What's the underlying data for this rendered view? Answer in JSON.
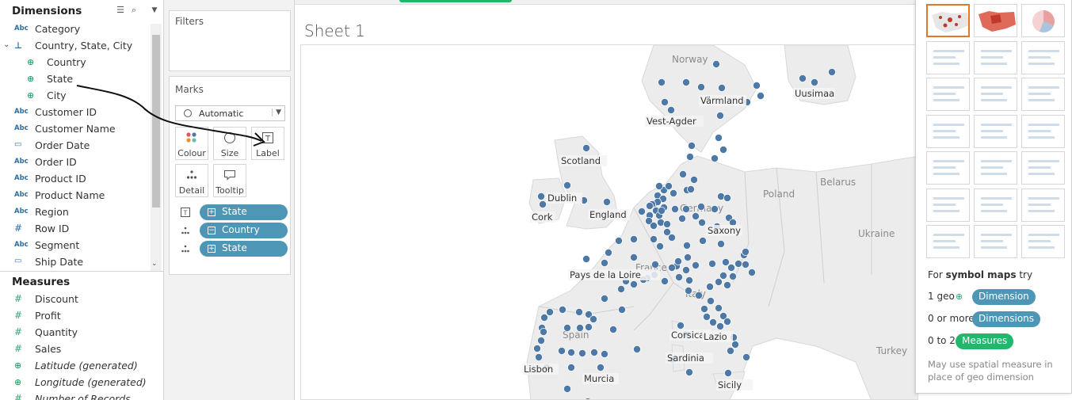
{
  "data_pane": {
    "dimensions_title": "Dimensions",
    "dimensions": [
      {
        "type": "Abc",
        "label": "Category"
      },
      {
        "type": "hier",
        "label": "Country, State, City",
        "expanded": true
      },
      {
        "type": "globe",
        "label": "Country",
        "child": true
      },
      {
        "type": "globe",
        "label": "State",
        "child": true
      },
      {
        "type": "globe",
        "label": "City",
        "child": true
      },
      {
        "type": "Abc",
        "label": "Customer ID"
      },
      {
        "type": "Abc",
        "label": "Customer Name"
      },
      {
        "type": "date",
        "label": "Order Date"
      },
      {
        "type": "Abc",
        "label": "Order ID"
      },
      {
        "type": "Abc",
        "label": "Product ID"
      },
      {
        "type": "Abc",
        "label": "Product Name"
      },
      {
        "type": "Abc",
        "label": "Region"
      },
      {
        "type": "#",
        "label": "Row ID"
      },
      {
        "type": "Abc",
        "label": "Segment"
      },
      {
        "type": "date",
        "label": "Ship Date"
      }
    ],
    "measures_title": "Measures",
    "measures": [
      {
        "type": "#",
        "label": "Discount"
      },
      {
        "type": "#",
        "label": "Profit"
      },
      {
        "type": "#",
        "label": "Quantity"
      },
      {
        "type": "#",
        "label": "Sales"
      },
      {
        "type": "globe",
        "label": "Latitude (generated)",
        "italic": true
      },
      {
        "type": "globe",
        "label": "Longitude (generated)",
        "italic": true
      },
      {
        "type": "#",
        "label": "Number of Records",
        "italic": true
      }
    ]
  },
  "shelves": {
    "filters_title": "Filters",
    "marks_title": "Marks",
    "mark_type": "Automatic",
    "mark_buttons": [
      "Colour",
      "Size",
      "Label",
      "Detail",
      "Tooltip"
    ],
    "mark_pills": [
      {
        "role": "label",
        "name": "State"
      },
      {
        "role": "detail",
        "name": "Country"
      },
      {
        "role": "detail",
        "name": "State"
      }
    ]
  },
  "worksheet": {
    "title": "Sheet 1",
    "map": {
      "country_labels": [
        "Norway",
        "Poland",
        "Belarus",
        "Ukraine",
        "Germany",
        "France",
        "Spain",
        "Italy",
        "Turkey"
      ],
      "state_labels": [
        "Värmland",
        "Uusimaa",
        "Vest-Agder",
        "Scotland",
        "Dublin",
        "Cork",
        "England",
        "Saxony",
        "Pays de la Loire",
        "Corsica",
        "Lazio",
        "Sardinia",
        "Lisbon",
        "Murcia",
        "Sicily"
      ]
    }
  },
  "show_me": {
    "for_prefix": "For ",
    "for_bold": "symbol maps",
    "for_suffix": " try",
    "req1_prefix": "1 geo",
    "req1_pill": "Dimension",
    "req2_prefix": "0 or more",
    "req2_pill": "Dimensions",
    "req3_prefix": "0 to 2",
    "req3_pill": "Measures",
    "footnote": "May use spatial measure in place of geo dimension",
    "colors": {
      "dimension": "#4d96b5",
      "measure": "#21b86c",
      "selected_border": "#e07a2a",
      "mark": "#4e79a7"
    }
  }
}
